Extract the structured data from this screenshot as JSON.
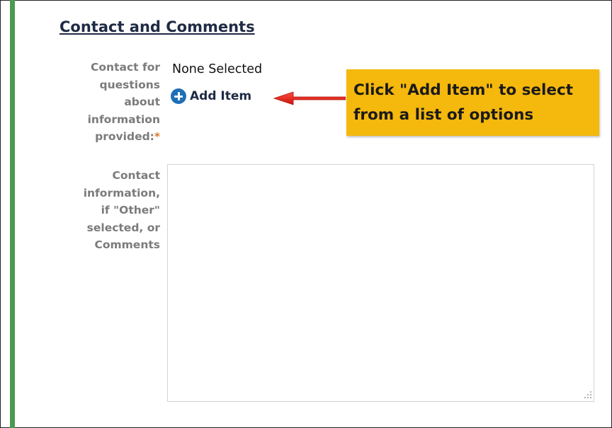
{
  "section": {
    "title": "Contact and Comments"
  },
  "contact_field": {
    "label": "Contact for\nquestions\nabout\ninformation\nprovided:",
    "required_marker": "*",
    "value": "None Selected",
    "add_item_label": "Add Item"
  },
  "comments_field": {
    "label": "Contact\ninformation,\nif \"Other\"\nselected, or\nComments",
    "value": ""
  },
  "callout": {
    "text": "Click \"Add Item\" to select\nfrom a list of options"
  },
  "colors": {
    "accent_bar": "#4a9a4f",
    "callout_bg": "#f5b80c",
    "arrow": "#e32b20",
    "add_icon": "#1e6fb6",
    "required": "#e0782b"
  }
}
